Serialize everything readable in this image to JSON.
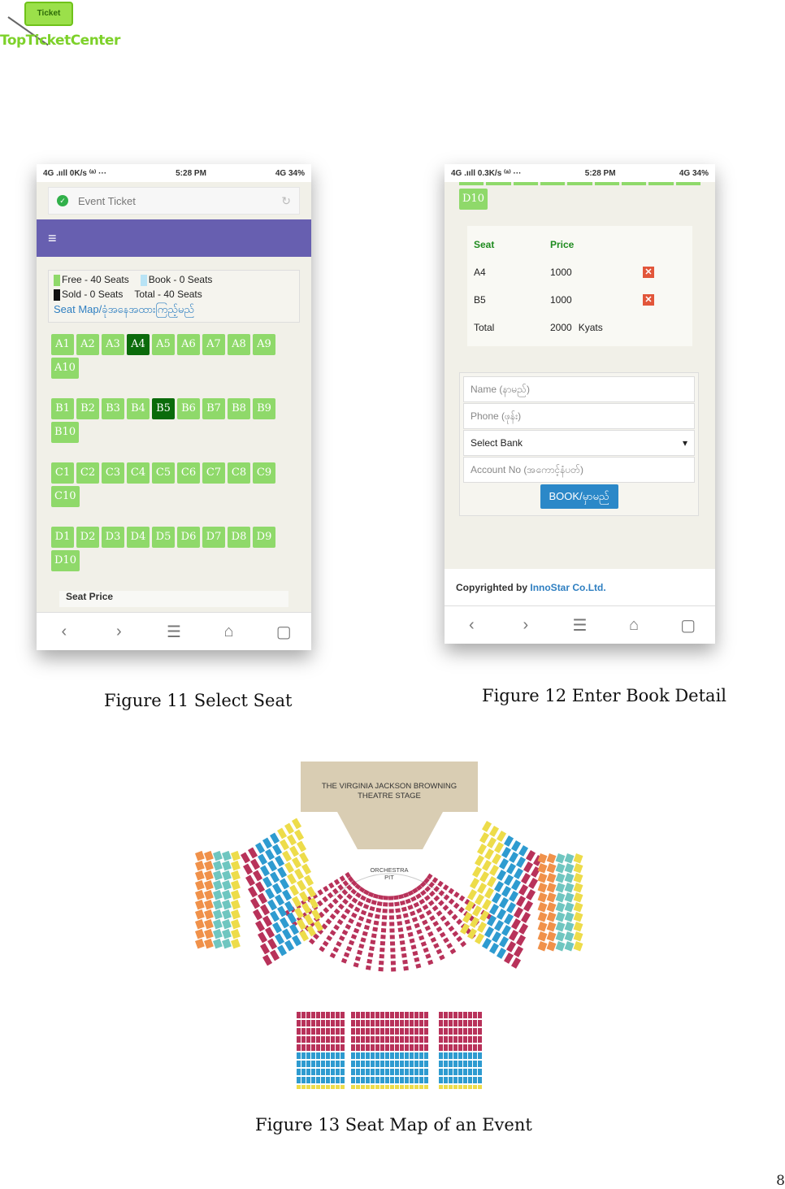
{
  "logo": {
    "tag": "Ticket",
    "name": "TopTicketCenter"
  },
  "phone1": {
    "status": {
      "left": "4G .ııll  0K/s ⁽ᵃ⁾ ···",
      "time": "5:28 PM",
      "right": "4G 34%"
    },
    "url_title": "Event Ticket",
    "menu_icon": "≡",
    "legend": {
      "free": "Free - 40 Seats",
      "book": "Book - 0 Seats",
      "sold": "Sold - 0 Seats",
      "total": "Total - 40 Seats",
      "map_link": "Seat Map/ခုံအနေအထားကြည့်မည်"
    },
    "rows": [
      [
        "A1",
        "A2",
        "A3",
        "A4",
        "A5",
        "A6",
        "A7",
        "A8",
        "A9",
        "A10"
      ],
      [
        "B1",
        "B2",
        "B3",
        "B4",
        "B5",
        "B6",
        "B7",
        "B8",
        "B9",
        "B10"
      ],
      [
        "C1",
        "C2",
        "C3",
        "C4",
        "C5",
        "C6",
        "C7",
        "C8",
        "C9",
        "C10"
      ],
      [
        "D1",
        "D2",
        "D3",
        "D4",
        "D5",
        "D6",
        "D7",
        "D8",
        "D9",
        "D10"
      ]
    ],
    "selected": [
      "A4",
      "B5"
    ],
    "peek_text": "Seat          Price"
  },
  "phone2": {
    "status": {
      "left": "4G .ııll  0.3K/s ⁽ᵃ⁾ ···",
      "time": "5:28 PM",
      "right": "4G 34%"
    },
    "top_seat": "D10",
    "table": {
      "head_seat": "Seat",
      "head_price": "Price",
      "rows": [
        {
          "seat": "A4",
          "price": "1000"
        },
        {
          "seat": "B5",
          "price": "1000"
        }
      ],
      "total_label": "Total",
      "total_value": "2000",
      "currency": "Kyats"
    },
    "form": {
      "name": "Name (နာမည်)",
      "phone": "Phone (ဖုန်း)",
      "bank": "Select Bank",
      "account": "Account No (အကောင့်နံပတ်)",
      "book": "BOOK/မှာမည်"
    },
    "copyright_prefix": "Copyrighted by",
    "copyright_link": "InnoStar Co.Ltd."
  },
  "captions": {
    "fig11": "Figure 11 Select Seat",
    "fig12": "Figure 12 Enter Book Detail",
    "fig13": "Figure 13 Seat Map of an Event"
  },
  "seatmap": {
    "stage": [
      "THE VIRGINIA JACKSON BROWNING",
      "THEATRE STAGE"
    ],
    "pit": [
      "ORCHESTRA",
      "PIT"
    ],
    "colors": {
      "red": "#b8325a",
      "blue": "#2e9bd0",
      "yellow": "#eddc4a",
      "orange": "#f0914a",
      "teal": "#6fc6c0",
      "black": "#222222"
    }
  },
  "page_number": "8",
  "nav_icons": [
    "back-icon",
    "forward-icon",
    "menu-icon",
    "home-icon",
    "tabs-icon"
  ]
}
